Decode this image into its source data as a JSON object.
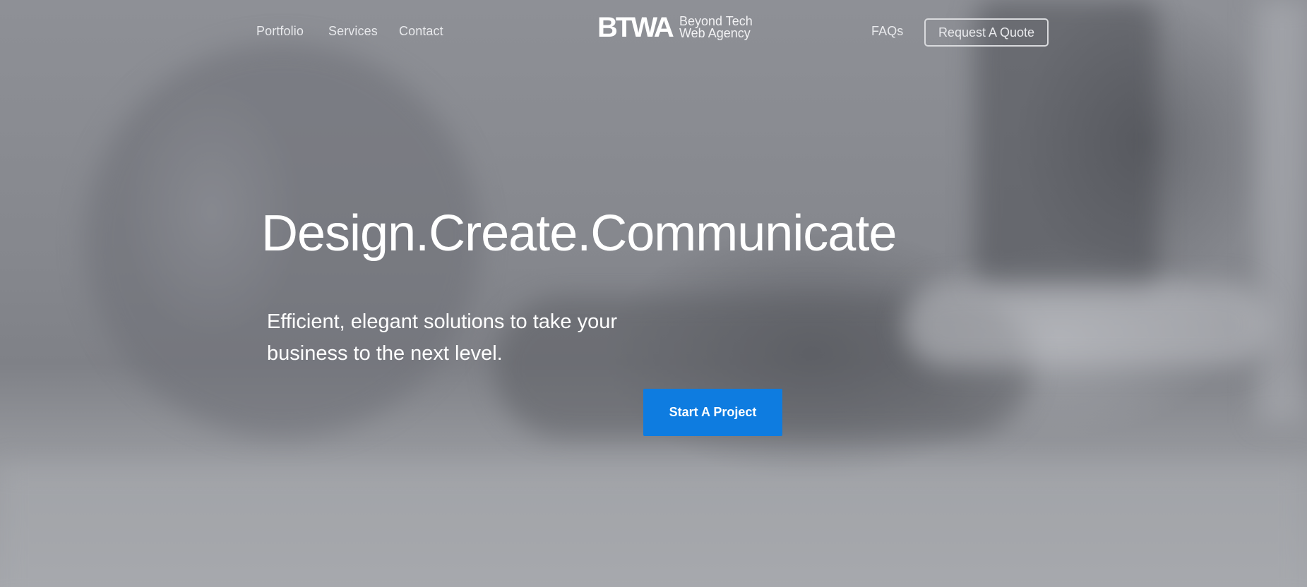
{
  "nav": {
    "left_links": [
      "Portfolio",
      "Services",
      "Contact"
    ],
    "right_links": [
      "FAQs"
    ],
    "quote_button": "Request A Quote"
  },
  "logo": {
    "mark": "BTWA",
    "line1": "Beyond Tech",
    "line2": "Web Agency"
  },
  "hero": {
    "headline": "Design.Create.Communicate",
    "subline_1": "Efficient, elegant solutions to take your",
    "subline_2": "business to the next level.",
    "cta": "Start A Project"
  },
  "colors": {
    "cta_background": "#0e7ce0",
    "text": "#ffffff",
    "overlay": "#8a8c92"
  }
}
